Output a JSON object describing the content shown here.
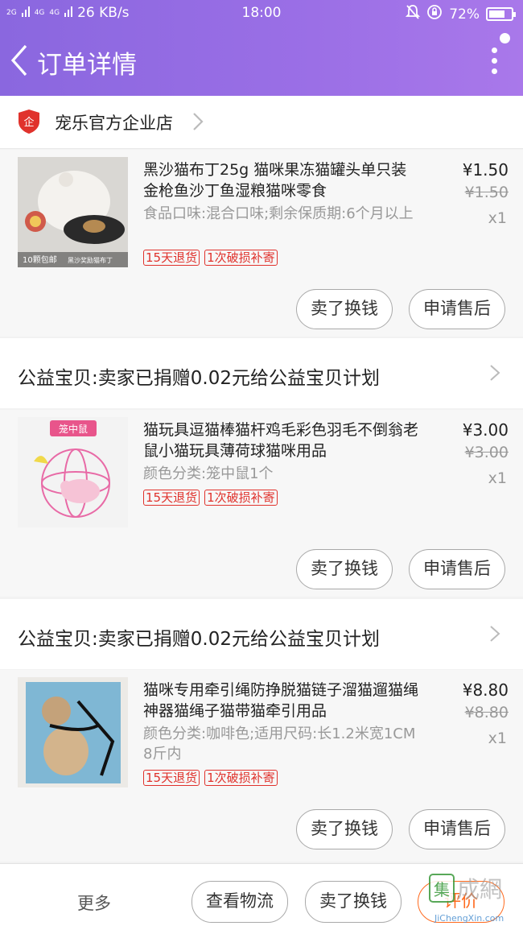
{
  "status_bar": {
    "signal_1": "2G",
    "signal_2": "4G",
    "signal_3": "4G",
    "speed": "26 KB/s",
    "time": "18:00",
    "battery": "72%",
    "battery_level": 0.72
  },
  "header": {
    "title": "订单详情"
  },
  "store": {
    "name": "宠乐官方企业店",
    "logo_text": "企"
  },
  "items": [
    {
      "name": "黑沙猫布丁25g 猫咪果冻猫罐头单只装金枪鱼沙丁鱼湿粮猫咪零食",
      "desc": "食品口味:混合口味;剩余保质期:6个月以上",
      "tags": [
        "15天退货",
        "1次破损补寄"
      ],
      "price": "¥1.50",
      "orig_price": "¥1.50",
      "qty": "x1",
      "thumb_caption_1": "10颗包邮",
      "thumb_caption_2": "黑沙奖励猫布丁",
      "btn_sell": "卖了换钱",
      "btn_aftersale": "申请售后"
    },
    {
      "name": "猫玩具逗猫棒猫杆鸡毛彩色羽毛不倒翁老鼠小猫玩具薄荷球猫咪用品",
      "desc": "颜色分类:笼中鼠1个",
      "tags": [
        "15天退货",
        "1次破损补寄"
      ],
      "price": "¥3.00",
      "orig_price": "¥3.00",
      "qty": "x1",
      "thumb_caption_1": "笼中鼠",
      "btn_sell": "卖了换钱",
      "btn_aftersale": "申请售后"
    },
    {
      "name": "猫咪专用牵引绳防挣脱猫链子溜猫遛猫绳神器猫绳子猫带猫牵引用品",
      "desc": "颜色分类:咖啡色;适用尺码:长1.2米宽1CM 8斤内",
      "tags": [
        "15天退货",
        "1次破损补寄"
      ],
      "price": "¥8.80",
      "orig_price": "¥8.80",
      "qty": "x1",
      "btn_sell": "卖了换钱",
      "btn_aftersale": "申请售后"
    }
  ],
  "charity": [
    {
      "text": "公益宝贝:卖家已捐赠0.02元给公益宝贝计划"
    },
    {
      "text": "公益宝贝:卖家已捐赠0.02元给公益宝贝计划"
    }
  ],
  "bottom_bar": {
    "more": "更多",
    "logistics": "查看物流",
    "sell": "卖了换钱",
    "evaluate": "评价"
  },
  "watermark": {
    "text": "集成网",
    "sub": "JiChengXin.com"
  },
  "colors": {
    "accent": "#8a67df",
    "tag_red": "#e0322c",
    "evaluate_orange": "#ff6a1e"
  }
}
